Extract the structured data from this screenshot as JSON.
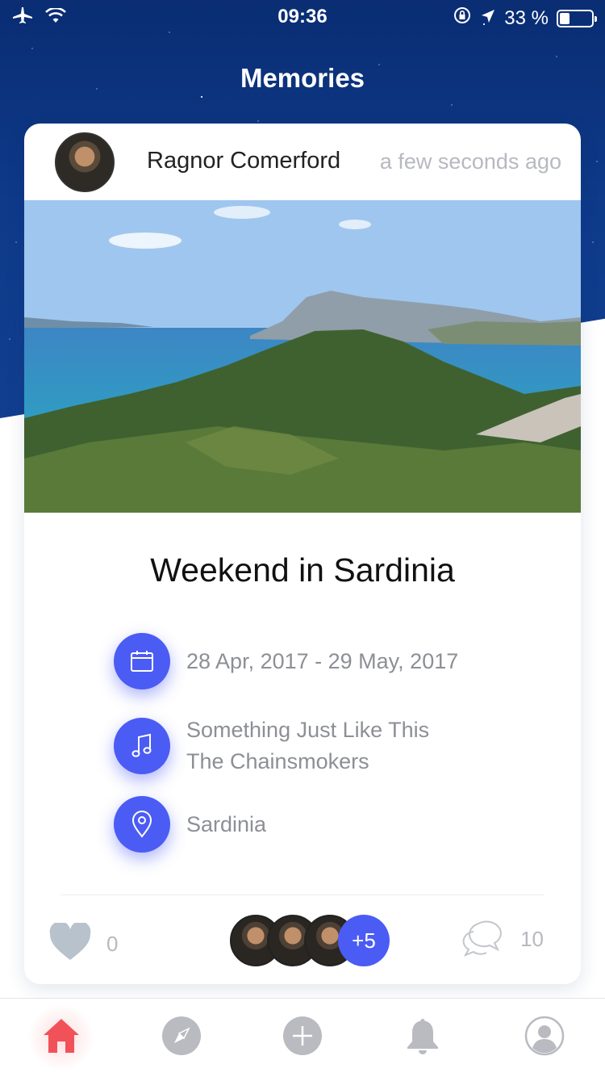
{
  "status_bar": {
    "time": "09:36",
    "battery_percent": "33 %",
    "battery_level": 0.33
  },
  "header": {
    "title": "Memories"
  },
  "memory": {
    "author": "Ragnor Comerford",
    "posted_time": "a few seconds ago",
    "title": "Weekend in Sardinia",
    "date_range": "28 Apr, 2017 - 29 May, 2017",
    "song_title": "Something Just Like This",
    "song_artist": "The Chainsmokers",
    "location": "Sardinia",
    "likes": "0",
    "participants_more": "+5",
    "comments": "10"
  },
  "icons": {
    "status_left": [
      "airplane-icon",
      "wifi-icon"
    ],
    "status_right": [
      "rotation-lock-icon",
      "location-arrow-icon",
      "battery-icon"
    ],
    "info": [
      "calendar-icon",
      "music-note-icon",
      "map-pin-icon"
    ],
    "footer": [
      "heart-icon",
      "comment-icon"
    ],
    "tabs": [
      "home-icon",
      "compass-icon",
      "add-icon",
      "bell-icon",
      "profile-icon"
    ]
  },
  "colors": {
    "accent": "#4b5cf4",
    "active_tab": "#f1525a",
    "inactive_tab": "#b9bbc1",
    "night_sky": "#0e3a8a"
  }
}
